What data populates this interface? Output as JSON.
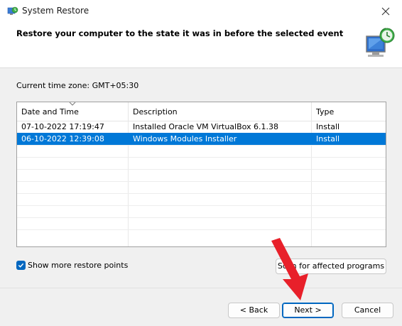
{
  "window": {
    "title": "System Restore",
    "header_title": "Restore your computer to the state it was in before the selected event",
    "icon_name": "system-restore-icon"
  },
  "timezone_text": "Current time zone: GMT+05:30",
  "table": {
    "columns": [
      "Date and Time",
      "Description",
      "Type"
    ],
    "rows": [
      {
        "date": "07-10-2022 17:19:47",
        "description": "Installed Oracle VM VirtualBox 6.1.38",
        "type": "Install",
        "selected": false
      },
      {
        "date": "06-10-2022 12:39:08",
        "description": "Windows Modules Installer",
        "type": "Install",
        "selected": true
      }
    ]
  },
  "show_more": {
    "label": "Show more restore points",
    "checked": true
  },
  "buttons": {
    "scan": "Scan for affected programs",
    "back": "< Back",
    "next": "Next >",
    "cancel": "Cancel"
  },
  "colors": {
    "selection": "#0078d7",
    "accent": "#0067c0",
    "annotation_arrow": "#e8202a"
  }
}
